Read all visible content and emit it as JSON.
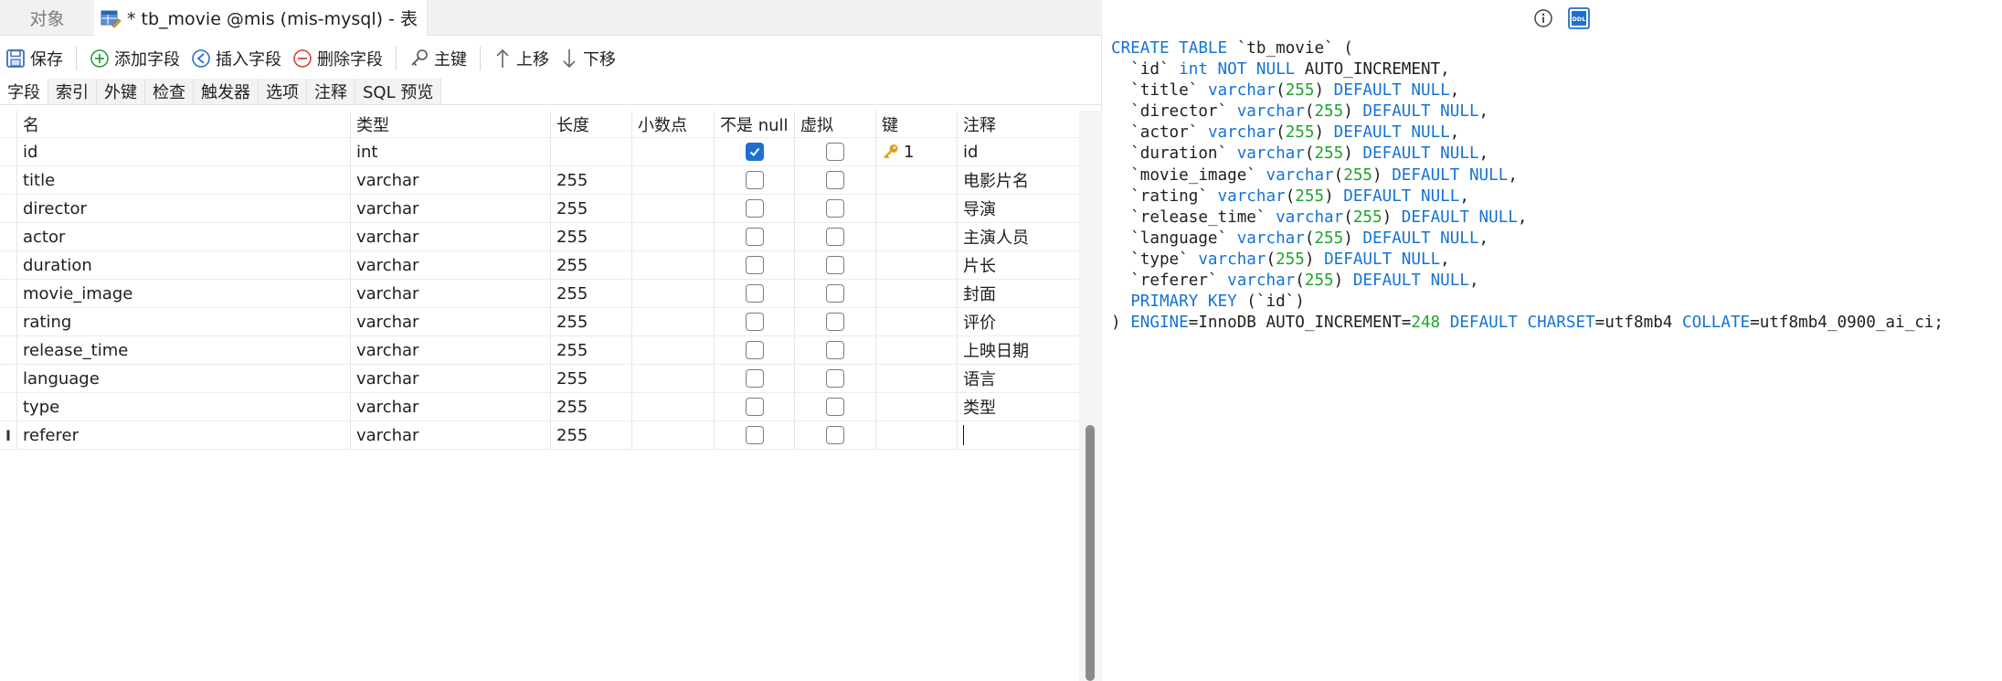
{
  "tabs": {
    "objects_label": "对象",
    "table_tab_label": "* tb_movie @mis (mis-mysql) - 表"
  },
  "toolbar": {
    "save": "保存",
    "add_field": "添加字段",
    "insert_field": "插入字段",
    "delete_field": "删除字段",
    "primary_key": "主键",
    "move_up": "上移",
    "move_down": "下移"
  },
  "subtabs": [
    "字段",
    "索引",
    "外键",
    "检查",
    "触发器",
    "选项",
    "注释",
    "SQL 预览"
  ],
  "columns": {
    "name": "名",
    "type": "类型",
    "length": "长度",
    "decimals": "小数点",
    "not_null": "不是 null",
    "virtual": "虚拟",
    "key": "键",
    "comment": "注释"
  },
  "fields": [
    {
      "name": "id",
      "type": "int",
      "length": "",
      "not_null": true,
      "virtual": false,
      "key": "1",
      "comment": "id"
    },
    {
      "name": "title",
      "type": "varchar",
      "length": "255",
      "not_null": false,
      "virtual": false,
      "key": "",
      "comment": "电影片名"
    },
    {
      "name": "director",
      "type": "varchar",
      "length": "255",
      "not_null": false,
      "virtual": false,
      "key": "",
      "comment": "导演"
    },
    {
      "name": "actor",
      "type": "varchar",
      "length": "255",
      "not_null": false,
      "virtual": false,
      "key": "",
      "comment": "主演人员"
    },
    {
      "name": "duration",
      "type": "varchar",
      "length": "255",
      "not_null": false,
      "virtual": false,
      "key": "",
      "comment": "片长"
    },
    {
      "name": "movie_image",
      "type": "varchar",
      "length": "255",
      "not_null": false,
      "virtual": false,
      "key": "",
      "comment": "封面"
    },
    {
      "name": "rating",
      "type": "varchar",
      "length": "255",
      "not_null": false,
      "virtual": false,
      "key": "",
      "comment": "评价"
    },
    {
      "name": "release_time",
      "type": "varchar",
      "length": "255",
      "not_null": false,
      "virtual": false,
      "key": "",
      "comment": "上映日期"
    },
    {
      "name": "language",
      "type": "varchar",
      "length": "255",
      "not_null": false,
      "virtual": false,
      "key": "",
      "comment": "语言"
    },
    {
      "name": "type",
      "type": "varchar",
      "length": "255",
      "not_null": false,
      "virtual": false,
      "key": "",
      "comment": "类型"
    },
    {
      "name": "referer",
      "type": "varchar",
      "length": "255",
      "not_null": false,
      "virtual": false,
      "key": "",
      "comment": ""
    }
  ],
  "sql_lines": [
    [
      [
        "kw",
        "CREATE TABLE "
      ],
      [
        "t",
        "`tb_movie` ("
      ]
    ],
    [
      [
        "t",
        "  `id` "
      ],
      [
        "kw",
        "int NOT NULL "
      ],
      [
        "t",
        "AUTO_INCREMENT,"
      ]
    ],
    [
      [
        "t",
        "  `title` "
      ],
      [
        "kw",
        "varchar"
      ],
      [
        "t",
        "("
      ],
      [
        "num",
        "255"
      ],
      [
        "t",
        ") "
      ],
      [
        "kw",
        "DEFAULT NULL"
      ],
      [
        "t",
        ","
      ]
    ],
    [
      [
        "t",
        "  `director` "
      ],
      [
        "kw",
        "varchar"
      ],
      [
        "t",
        "("
      ],
      [
        "num",
        "255"
      ],
      [
        "t",
        ") "
      ],
      [
        "kw",
        "DEFAULT NULL"
      ],
      [
        "t",
        ","
      ]
    ],
    [
      [
        "t",
        "  `actor` "
      ],
      [
        "kw",
        "varchar"
      ],
      [
        "t",
        "("
      ],
      [
        "num",
        "255"
      ],
      [
        "t",
        ") "
      ],
      [
        "kw",
        "DEFAULT NULL"
      ],
      [
        "t",
        ","
      ]
    ],
    [
      [
        "t",
        "  `duration` "
      ],
      [
        "kw",
        "varchar"
      ],
      [
        "t",
        "("
      ],
      [
        "num",
        "255"
      ],
      [
        "t",
        ") "
      ],
      [
        "kw",
        "DEFAULT NULL"
      ],
      [
        "t",
        ","
      ]
    ],
    [
      [
        "t",
        "  `movie_image` "
      ],
      [
        "kw",
        "varchar"
      ],
      [
        "t",
        "("
      ],
      [
        "num",
        "255"
      ],
      [
        "t",
        ") "
      ],
      [
        "kw",
        "DEFAULT NULL"
      ],
      [
        "t",
        ","
      ]
    ],
    [
      [
        "t",
        "  `rating` "
      ],
      [
        "kw",
        "varchar"
      ],
      [
        "t",
        "("
      ],
      [
        "num",
        "255"
      ],
      [
        "t",
        ") "
      ],
      [
        "kw",
        "DEFAULT NULL"
      ],
      [
        "t",
        ","
      ]
    ],
    [
      [
        "t",
        "  `release_time` "
      ],
      [
        "kw",
        "varchar"
      ],
      [
        "t",
        "("
      ],
      [
        "num",
        "255"
      ],
      [
        "t",
        ") "
      ],
      [
        "kw",
        "DEFAULT NULL"
      ],
      [
        "t",
        ","
      ]
    ],
    [
      [
        "t",
        "  `language` "
      ],
      [
        "kw",
        "varchar"
      ],
      [
        "t",
        "("
      ],
      [
        "num",
        "255"
      ],
      [
        "t",
        ") "
      ],
      [
        "kw",
        "DEFAULT NULL"
      ],
      [
        "t",
        ","
      ]
    ],
    [
      [
        "t",
        "  `type` "
      ],
      [
        "kw",
        "varchar"
      ],
      [
        "t",
        "("
      ],
      [
        "num",
        "255"
      ],
      [
        "t",
        ") "
      ],
      [
        "kw",
        "DEFAULT NULL"
      ],
      [
        "t",
        ","
      ]
    ],
    [
      [
        "t",
        "  `referer` "
      ],
      [
        "kw",
        "varchar"
      ],
      [
        "t",
        "("
      ],
      [
        "num",
        "255"
      ],
      [
        "t",
        ") "
      ],
      [
        "kw",
        "DEFAULT NULL"
      ],
      [
        "t",
        ","
      ]
    ],
    [
      [
        "t",
        "  "
      ],
      [
        "kw",
        "PRIMARY KEY "
      ],
      [
        "t",
        "(`id`)"
      ]
    ],
    [
      [
        "t",
        ") "
      ],
      [
        "kw",
        "ENGINE"
      ],
      [
        "t",
        "=InnoDB AUTO_INCREMENT="
      ],
      [
        "num",
        "248"
      ],
      [
        "t",
        " "
      ],
      [
        "kw",
        "DEFAULT CHARSET"
      ],
      [
        "t",
        "=utf8mb4 "
      ],
      [
        "kw",
        "COLLATE"
      ],
      [
        "t",
        "=utf8mb4_0900_ai_ci;"
      ]
    ]
  ],
  "colors": {
    "keyword": "#1573d4",
    "number": "#21a32a",
    "checked": "#1f6fd1",
    "key_icon": "#e0a020"
  },
  "icons": {
    "info": "info-icon",
    "ddl": "ddl-icon",
    "ddl_label": "DDL"
  }
}
